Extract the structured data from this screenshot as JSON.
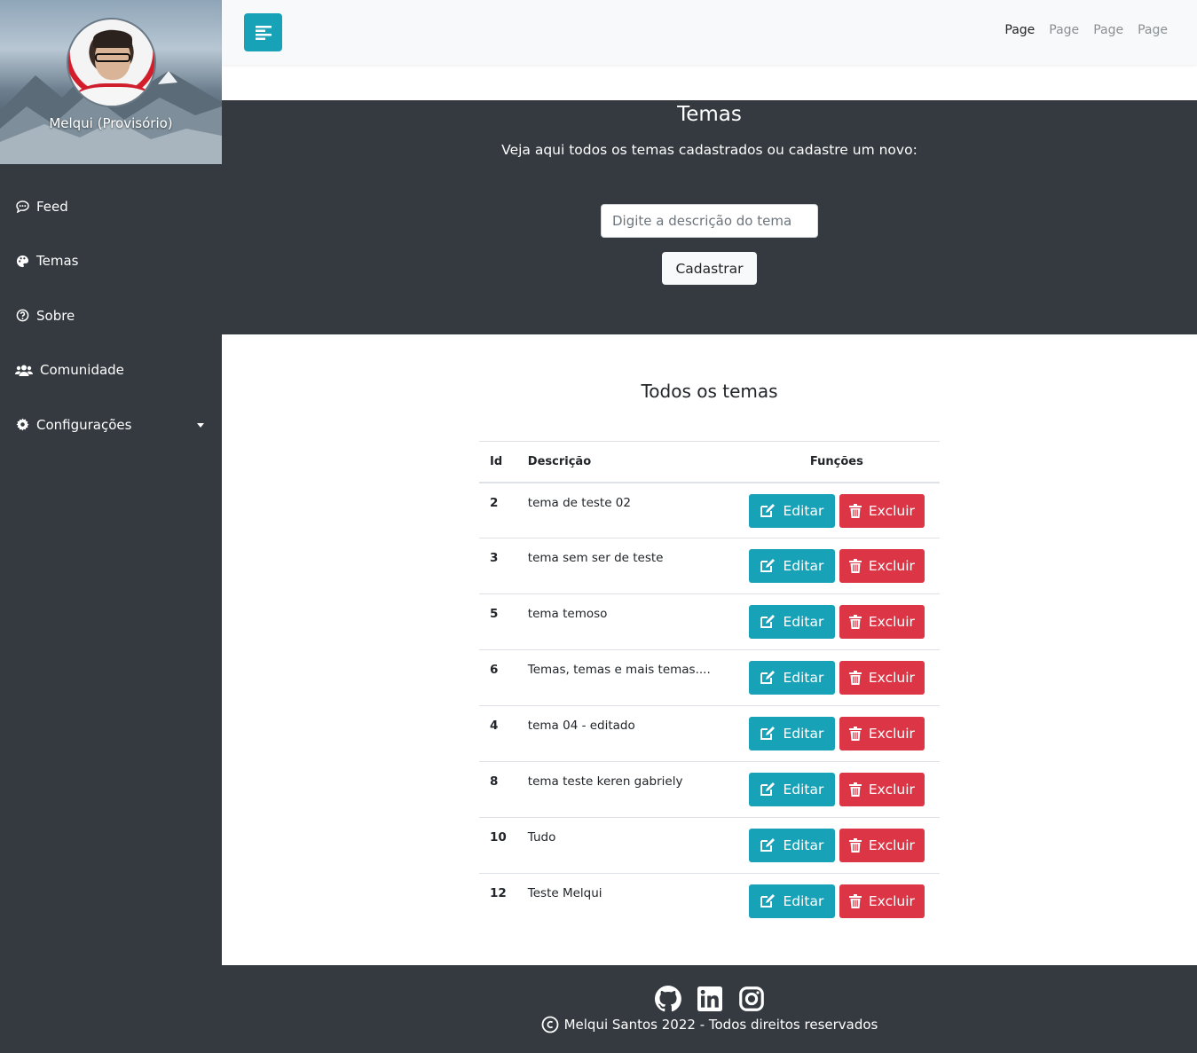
{
  "sidebar": {
    "profile_name": "Melqui (Provisório)",
    "items": [
      {
        "label": "Feed",
        "icon": "comment-dots-icon"
      },
      {
        "label": "Temas",
        "icon": "palette-icon"
      },
      {
        "label": "Sobre",
        "icon": "question-circle-icon"
      },
      {
        "label": "Comunidade",
        "icon": "users-icon"
      },
      {
        "label": "Configurações",
        "icon": "gear-icon"
      }
    ]
  },
  "topbar": {
    "links": [
      "Page",
      "Page",
      "Page",
      "Page"
    ]
  },
  "hero": {
    "title": "Temas",
    "subtitle": "Veja aqui todos os temas cadastrados ou cadastre um novo:",
    "input_placeholder": "Digite a descrição do tema",
    "submit_label": "Cadastrar"
  },
  "table": {
    "title": "Todos os temas",
    "headers": {
      "id": "Id",
      "desc": "Descrição",
      "fn": "Funções"
    },
    "edit_label": "Editar",
    "delete_label": "Excluir",
    "rows": [
      {
        "id": "2",
        "desc": "tema de teste 02"
      },
      {
        "id": "3",
        "desc": "tema sem ser de teste"
      },
      {
        "id": "5",
        "desc": "tema temoso"
      },
      {
        "id": "6",
        "desc": "Temas, temas e mais temas...."
      },
      {
        "id": "4",
        "desc": "tema 04 - editado"
      },
      {
        "id": "8",
        "desc": "tema teste keren gabriely"
      },
      {
        "id": "10",
        "desc": "Tudo"
      },
      {
        "id": "12",
        "desc": "Teste Melqui"
      }
    ]
  },
  "footer": {
    "copyright": "Melqui Santos 2022 - Todos direitos reservados",
    "social": [
      "github-icon",
      "linkedin-icon",
      "instagram-icon"
    ]
  },
  "colors": {
    "primary": "#17a2b8",
    "danger": "#dc3545",
    "dark": "#343a40",
    "light": "#f8f9fa"
  }
}
